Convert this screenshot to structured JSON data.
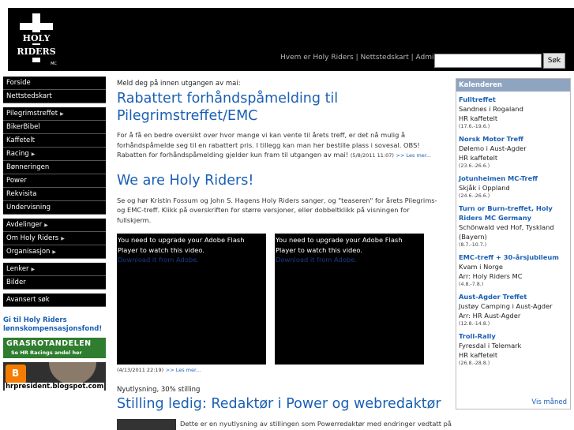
{
  "header": {
    "logo_line1": "HOLY",
    "logo_line2": "RIDERS",
    "logo_badge": "MC",
    "links": [
      "Hvem er Holy Riders",
      "Nettstedskart",
      "Admin"
    ],
    "link_separator": " | ",
    "search_placeholder": "",
    "search_button": "Søk"
  },
  "sidebar": {
    "groups": [
      [
        {
          "label": "Forside",
          "arrow": false
        },
        {
          "label": "Nettstedskart",
          "arrow": false
        }
      ],
      [
        {
          "label": "Pilegrimstreffet",
          "arrow": true
        },
        {
          "label": "BikerBibel",
          "arrow": false
        },
        {
          "label": "Kaffetelt",
          "arrow": false
        },
        {
          "label": "Racing",
          "arrow": true
        },
        {
          "label": "Bønneringen",
          "arrow": false
        },
        {
          "label": "Power",
          "arrow": false
        },
        {
          "label": "Rekvisita",
          "arrow": false
        },
        {
          "label": "Undervisning",
          "arrow": false
        }
      ],
      [
        {
          "label": "Avdelinger",
          "arrow": true
        },
        {
          "label": "Om Holy Riders",
          "arrow": true
        },
        {
          "label": "Organisasjon",
          "arrow": true
        }
      ],
      [
        {
          "label": "Lenker",
          "arrow": true
        },
        {
          "label": "Bilder",
          "arrow": false
        }
      ],
      [
        {
          "label": "Avansert søk",
          "arrow": false
        }
      ]
    ],
    "promo_text": "Gi til Holy Riders lønnskompensasjonsfond!",
    "grasrot_title": "GRASROTANDELEN",
    "grasrot_sub": "Se HR Racings andel her",
    "blog_icon": "B",
    "blog_url": "hrpresident.blogspot.com"
  },
  "main": {
    "article1": {
      "kicker": "Meld deg på innen utgangen av mai:",
      "title": "Rabattert forhåndspåmelding til Pilegrimstreffet/EMC",
      "body": "For å få en bedre oversikt over hvor mange vi kan vente til årets treff, er det nå mulig å forhåndspåmelde seg til en rabattert pris. I tillegg kan man her bestille plass i sovesal. OBS! Rabatten for forhåndspåmelding gjelder kun fram til utgangen av mai!",
      "date": "(5/8/2011 11:07)",
      "more": ">> Les mer..."
    },
    "article2": {
      "title": "We are Holy Riders!",
      "body": "Se og hør Kristin Fossum og John S. Hagens Holy Riders sanger, og \"teaseren\" for årets Pilegrims- og EMC-treff. Klikk på overskriften for større versjoner, eller dobbeltklikk på visningen for fullskjerm.",
      "video_msg": "You need to upgrade your Adobe Flash Player to watch this video.",
      "video_link": "Download it from Adobe.",
      "date": "(4/13/2011 22:19)",
      "more": ">> Les mer..."
    },
    "article3": {
      "kicker": "Nyutlysning, 30% stilling",
      "title": "Stilling ledig: Redaktør i Power og webredaktør",
      "body": "Dette er en nyutlysning av stillingen som Powerredaktør med endringer vedtatt på"
    }
  },
  "calendar": {
    "title": "Kalenderen",
    "events": [
      {
        "name": "Fulltreffet",
        "lines": [
          "Sandnes i Rogaland",
          "HR kaffetelt"
        ],
        "date": "(17.6.-19.6.)"
      },
      {
        "name": "Norsk Motor Treff",
        "lines": [
          "Dølemo i Aust-Agder",
          "HR kaffetelt"
        ],
        "date": "(23.6.-26.6.)"
      },
      {
        "name": "Jotunheimen MC-Treff",
        "lines": [
          "Skjåk i Oppland"
        ],
        "date": "(24.6.-26.6.)"
      },
      {
        "name": "Turn or Burn-treffet, Holy Riders MC Germany",
        "lines": [
          "Schönwald ved Hof, Tyskland (Bayern)"
        ],
        "date": "(8.7.-10.7.)"
      },
      {
        "name": "EMC-treff + 30-årsjubileum",
        "lines": [
          "Kvam i Norge",
          "Arr: Holy Riders MC"
        ],
        "date": "(4.8.-7.8.)"
      },
      {
        "name": "Aust-Agder Treffet",
        "lines": [
          "Justøy Camping i Aust-Agder",
          "Arr: HR Aust-Agder"
        ],
        "date": "(12.8.-14.8.)"
      },
      {
        "name": "Troll-Rally",
        "lines": [
          "Fyresdal i Telemark",
          "HR kaffetelt"
        ],
        "date": "(26.8.-28.8.)"
      }
    ],
    "more": "Vis måned"
  }
}
